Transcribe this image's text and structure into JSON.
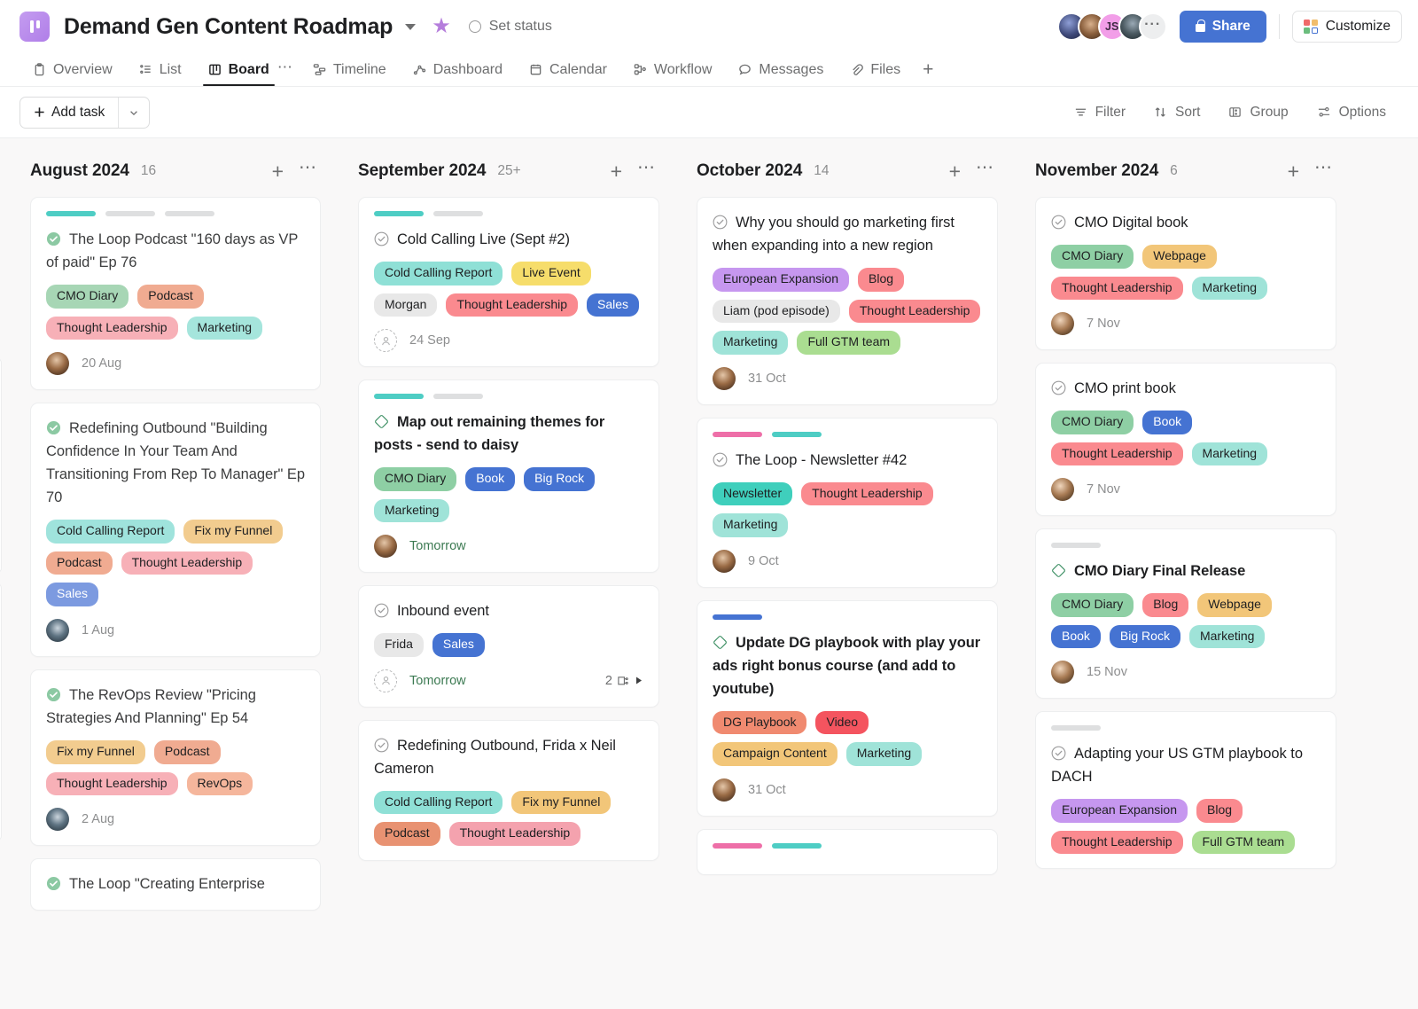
{
  "header": {
    "project_title": "Demand Gen Content Roadmap",
    "set_status_label": "Set status",
    "share_label": "Share",
    "customize_label": "Customize",
    "avatar_initials": "JS",
    "avatar_more": "···",
    "accent_color": "#4573d2",
    "star_color": "#b57edc"
  },
  "tabs": [
    {
      "label": "Overview",
      "icon": "clipboard-icon",
      "active": false
    },
    {
      "label": "List",
      "icon": "list-icon",
      "active": false
    },
    {
      "label": "Board",
      "icon": "board-icon",
      "active": true
    },
    {
      "label": "Timeline",
      "icon": "timeline-icon",
      "active": false
    },
    {
      "label": "Dashboard",
      "icon": "dashboard-icon",
      "active": false
    },
    {
      "label": "Calendar",
      "icon": "calendar-icon",
      "active": false
    },
    {
      "label": "Workflow",
      "icon": "workflow-icon",
      "active": false
    },
    {
      "label": "Messages",
      "icon": "message-icon",
      "active": false
    },
    {
      "label": "Files",
      "icon": "paperclip-icon",
      "active": false
    }
  ],
  "tab_add_label": "+",
  "toolbar": {
    "add_task_label": "Add task",
    "filter_label": "Filter",
    "sort_label": "Sort",
    "group_label": "Group",
    "options_label": "Options"
  },
  "columns": [
    {
      "title": "August 2024",
      "count": "16",
      "cards": [
        {
          "title": "The Loop Podcast \"160 days as VP of paid\" Ep 76",
          "status": "complete",
          "style": "normal",
          "pills": [
            "teal",
            "grey",
            "grey"
          ],
          "tags": [
            {
              "label": "CMO Diary",
              "bg": "#a7d6b5",
              "fg": "dark"
            },
            {
              "label": "Podcast",
              "bg": "#f0ab91",
              "fg": "dark"
            },
            {
              "label": "Thought Leadership",
              "bg": "#f7b0b7",
              "fg": "dark"
            },
            {
              "label": "Marketing",
              "bg": "#a5e5dc",
              "fg": "dark"
            }
          ],
          "avatar": "p1",
          "date": "20 Aug",
          "date_style": "grey",
          "subtask_count": ""
        },
        {
          "title": "Redefining Outbound \"Building Confidence In Your Team And Transitioning From Rep To Manager\" Ep 70",
          "status": "complete",
          "style": "normal",
          "pills": [],
          "tags": [
            {
              "label": "Cold Calling Report",
              "bg": "#9fe3dc",
              "fg": "dark"
            },
            {
              "label": "Fix my Funnel",
              "bg": "#f2cc8f",
              "fg": "dark"
            },
            {
              "label": "Podcast",
              "bg": "#f0ab91",
              "fg": "dark"
            },
            {
              "label": "Thought Leadership",
              "bg": "#f7b0b7",
              "fg": "dark"
            },
            {
              "label": "Sales",
              "bg": "#7c9ae0",
              "fg": "white"
            }
          ],
          "avatar": "p2",
          "date": "1 Aug",
          "date_style": "grey",
          "subtask_count": ""
        },
        {
          "title": "The RevOps Review \"Pricing Strategies And Planning\" Ep 54",
          "status": "complete",
          "style": "normal",
          "pills": [],
          "tags": [
            {
              "label": "Fix my Funnel",
              "bg": "#f2cc8f",
              "fg": "dark"
            },
            {
              "label": "Podcast",
              "bg": "#f0ab91",
              "fg": "dark"
            },
            {
              "label": "Thought Leadership",
              "bg": "#f7b0b7",
              "fg": "dark"
            },
            {
              "label": "RevOps",
              "bg": "#f5b69c",
              "fg": "dark"
            }
          ],
          "avatar": "p2",
          "date": "2 Aug",
          "date_style": "grey",
          "subtask_count": ""
        },
        {
          "title": "The Loop \"Creating Enterprise",
          "status": "complete",
          "style": "normal",
          "pills": [],
          "tags": [],
          "avatar": "",
          "date": "",
          "date_style": "grey",
          "subtask_count": ""
        }
      ]
    },
    {
      "title": "September 2024",
      "count": "25+",
      "cards": [
        {
          "title": "Cold Calling Live (Sept #2)",
          "status": "incomplete",
          "style": "plain",
          "pills": [
            "teal",
            "grey"
          ],
          "tags": [
            {
              "label": "Cold Calling Report",
              "bg": "#8fe0d6",
              "fg": "dark"
            },
            {
              "label": "Live Event",
              "bg": "#f6dd6b",
              "fg": "dark"
            },
            {
              "label": "Morgan",
              "bg": "#e8e8e8",
              "fg": "dark"
            },
            {
              "label": "Thought Leadership",
              "bg": "#fa8a8f",
              "fg": "dark"
            },
            {
              "label": "Sales",
              "bg": "#4573d2",
              "fg": "white"
            }
          ],
          "avatar": "none",
          "date": "24 Sep",
          "date_style": "grey",
          "subtask_count": ""
        },
        {
          "title": "Map out remaining themes for posts - send to daisy",
          "status": "milestone",
          "style": "milestone",
          "pills": [
            "teal",
            "grey"
          ],
          "tags": [
            {
              "label": "CMO Diary",
              "bg": "#8ecfa4",
              "fg": "dark"
            },
            {
              "label": "Book",
              "bg": "#4573d2",
              "fg": "white"
            },
            {
              "label": "Big Rock",
              "bg": "#4573d2",
              "fg": "white"
            },
            {
              "label": "Marketing",
              "bg": "#9fe3d8",
              "fg": "dark"
            }
          ],
          "avatar": "p1",
          "date": "Tomorrow",
          "date_style": "green",
          "subtask_count": ""
        },
        {
          "title": "Inbound event",
          "status": "incomplete",
          "style": "plain",
          "pills": [],
          "tags": [
            {
              "label": "Frida",
              "bg": "#e8e8e8",
              "fg": "dark"
            },
            {
              "label": "Sales",
              "bg": "#4573d2",
              "fg": "white"
            }
          ],
          "avatar": "none",
          "date": "Tomorrow",
          "date_style": "green",
          "subtask_count": "2"
        },
        {
          "title": "Redefining Outbound, Frida x Neil Cameron",
          "status": "incomplete",
          "style": "plain",
          "pills": [],
          "tags": [
            {
              "label": "Cold Calling Report",
              "bg": "#8fe0d6",
              "fg": "dark"
            },
            {
              "label": "Fix my Funnel",
              "bg": "#f2c679",
              "fg": "dark"
            },
            {
              "label": "Podcast",
              "bg": "#e89272",
              "fg": "dark"
            },
            {
              "label": "Thought Leadership",
              "bg": "#f4a2ae",
              "fg": "dark"
            }
          ],
          "avatar": "",
          "date": "",
          "date_style": "grey",
          "subtask_count": ""
        }
      ]
    },
    {
      "title": "October 2024",
      "count": "14",
      "cards": [
        {
          "title": "Why you should go marketing first when expanding into a new region",
          "status": "incomplete",
          "style": "plain",
          "pills": [],
          "tags": [
            {
              "label": "European Expansion",
              "bg": "#c697ef",
              "fg": "dark"
            },
            {
              "label": "Blog",
              "bg": "#fa8a8f",
              "fg": "dark"
            },
            {
              "label": "Liam (pod episode)",
              "bg": "#e8e8e8",
              "fg": "dark"
            },
            {
              "label": "Thought Leadership",
              "bg": "#fa8a8f",
              "fg": "dark"
            },
            {
              "label": "Marketing",
              "bg": "#9fe3d8",
              "fg": "dark"
            },
            {
              "label": "Full GTM team",
              "bg": "#aadd91",
              "fg": "dark"
            }
          ],
          "avatar": "p1",
          "date": "31 Oct",
          "date_style": "grey",
          "subtask_count": ""
        },
        {
          "title": "The Loop - Newsletter #42",
          "status": "incomplete",
          "style": "plain",
          "pills": [
            "pink",
            "teal"
          ],
          "tags": [
            {
              "label": "Newsletter",
              "bg": "#3fcfbc",
              "fg": "dark"
            },
            {
              "label": "Thought Leadership",
              "bg": "#fa8a8f",
              "fg": "dark"
            },
            {
              "label": "Marketing",
              "bg": "#9fe3d8",
              "fg": "dark"
            }
          ],
          "avatar": "p1",
          "date": "9 Oct",
          "date_style": "grey",
          "subtask_count": ""
        },
        {
          "title": "Update DG playbook with play your ads right bonus course (and add to youtube)",
          "status": "milestone",
          "style": "milestone",
          "pills": [
            "blue"
          ],
          "tags": [
            {
              "label": "DG Playbook",
              "bg": "#f08a70",
              "fg": "dark"
            },
            {
              "label": "Video",
              "bg": "#f4545f",
              "fg": "dark"
            },
            {
              "label": "Campaign Content",
              "bg": "#f2c679",
              "fg": "dark"
            },
            {
              "label": "Marketing",
              "bg": "#9fe3d8",
              "fg": "dark"
            }
          ],
          "avatar": "p1",
          "date": "31 Oct",
          "date_style": "grey",
          "subtask_count": ""
        },
        {
          "title": "",
          "status": "none",
          "style": "plain",
          "pills": [
            "pink",
            "teal"
          ],
          "tags": [],
          "avatar": "",
          "date": "",
          "date_style": "grey",
          "subtask_count": ""
        }
      ]
    },
    {
      "title": "November 2024",
      "count": "6",
      "cards": [
        {
          "title": "CMO Digital book",
          "status": "incomplete",
          "style": "plain",
          "pills": [],
          "tags": [
            {
              "label": "CMO Diary",
              "bg": "#8ecfa4",
              "fg": "dark"
            },
            {
              "label": "Webpage",
              "bg": "#f2c679",
              "fg": "dark"
            },
            {
              "label": "Thought Leadership",
              "bg": "#fa8a8f",
              "fg": "dark"
            },
            {
              "label": "Marketing",
              "bg": "#9fe3d8",
              "fg": "dark"
            }
          ],
          "avatar": "p3",
          "date": "7 Nov",
          "date_style": "grey",
          "subtask_count": ""
        },
        {
          "title": "CMO print book",
          "status": "incomplete",
          "style": "plain",
          "pills": [],
          "tags": [
            {
              "label": "CMO Diary",
              "bg": "#8ecfa4",
              "fg": "dark"
            },
            {
              "label": "Book",
              "bg": "#4573d2",
              "fg": "white"
            },
            {
              "label": "Thought Leadership",
              "bg": "#fa8a8f",
              "fg": "dark"
            },
            {
              "label": "Marketing",
              "bg": "#9fe3d8",
              "fg": "dark"
            }
          ],
          "avatar": "p3",
          "date": "7 Nov",
          "date_style": "grey",
          "subtask_count": ""
        },
        {
          "title": "CMO Diary Final Release",
          "status": "milestone",
          "style": "milestone",
          "pills": [
            "grey"
          ],
          "tags": [
            {
              "label": "CMO Diary",
              "bg": "#8ecfa4",
              "fg": "dark"
            },
            {
              "label": "Blog",
              "bg": "#fa8a8f",
              "fg": "dark"
            },
            {
              "label": "Webpage",
              "bg": "#f2c679",
              "fg": "dark"
            },
            {
              "label": "Book",
              "bg": "#4573d2",
              "fg": "white"
            },
            {
              "label": "Big Rock",
              "bg": "#4573d2",
              "fg": "white"
            },
            {
              "label": "Marketing",
              "bg": "#9fe3d8",
              "fg": "dark"
            }
          ],
          "avatar": "p3",
          "date": "15 Nov",
          "date_style": "grey",
          "subtask_count": ""
        },
        {
          "title": "Adapting your US GTM playbook to DACH",
          "status": "incomplete",
          "style": "plain",
          "pills": [
            "grey"
          ],
          "tags": [
            {
              "label": "European Expansion",
              "bg": "#c697ef",
              "fg": "dark"
            },
            {
              "label": "Blog",
              "bg": "#fa8a8f",
              "fg": "dark"
            },
            {
              "label": "Thought Leadership",
              "bg": "#fa8a8f",
              "fg": "dark"
            },
            {
              "label": "Full GTM team",
              "bg": "#aadd91",
              "fg": "dark"
            }
          ],
          "avatar": "",
          "date": "",
          "date_style": "grey",
          "subtask_count": ""
        }
      ]
    }
  ]
}
